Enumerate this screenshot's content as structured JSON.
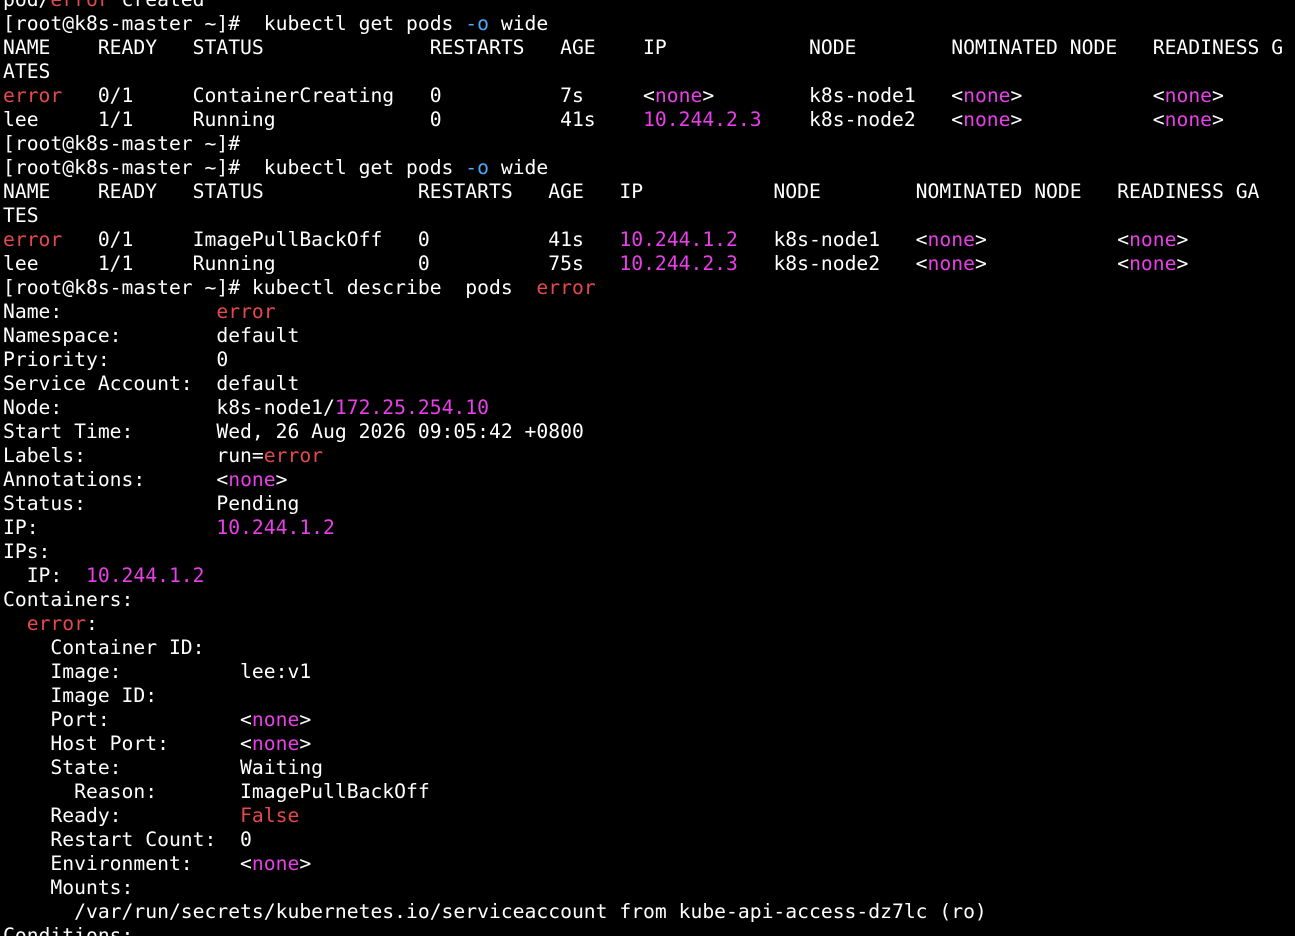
{
  "colors": {
    "background": "#000000",
    "default_text": "#ffffff",
    "red": "#e5484d",
    "magenta": "#e83fe8",
    "blue": "#4aa8ff"
  },
  "terminal": {
    "lines": [
      {
        "name": "output-created",
        "segs": [
          {
            "t": "pod/",
            "c": "t"
          },
          {
            "t": "error",
            "c": "r"
          },
          {
            "t": " created",
            "c": "t"
          }
        ]
      },
      {
        "name": "prompt-get-pods-1",
        "segs": [
          {
            "t": "[root@k8s-master ~]#  kubectl get pods ",
            "c": "t"
          },
          {
            "t": "-o",
            "c": "b"
          },
          {
            "t": " wide",
            "c": "t"
          }
        ]
      },
      {
        "name": "pods-header-1",
        "segs": [
          {
            "t": "NAME    READY   STATUS              RESTARTS   AGE    IP            NODE        NOMINATED NODE   READINESS G",
            "c": "t"
          }
        ]
      },
      {
        "name": "pods-header-1-wrap",
        "segs": [
          {
            "t": "ATES",
            "c": "t"
          }
        ]
      },
      {
        "name": "pod-row-error-1",
        "segs": [
          {
            "t": "error",
            "c": "r"
          },
          {
            "t": "   0/1     ContainerCreating   0          7s     <",
            "c": "t"
          },
          {
            "t": "none",
            "c": "m"
          },
          {
            "t": ">        k8s-node1   <",
            "c": "t"
          },
          {
            "t": "none",
            "c": "m"
          },
          {
            "t": ">           <",
            "c": "t"
          },
          {
            "t": "none",
            "c": "m"
          },
          {
            "t": ">",
            "c": "t"
          }
        ]
      },
      {
        "name": "pod-row-lee-1",
        "segs": [
          {
            "t": "lee     1/1     Running             0          41s    ",
            "c": "t"
          },
          {
            "t": "10.244.2.3",
            "c": "m"
          },
          {
            "t": "    k8s-node2   <",
            "c": "t"
          },
          {
            "t": "none",
            "c": "m"
          },
          {
            "t": ">           <",
            "c": "t"
          },
          {
            "t": "none",
            "c": "m"
          },
          {
            "t": ">",
            "c": "t"
          }
        ]
      },
      {
        "name": "prompt-empty",
        "segs": [
          {
            "t": "[root@k8s-master ~]#",
            "c": "t"
          }
        ]
      },
      {
        "name": "prompt-get-pods-2",
        "segs": [
          {
            "t": "[root@k8s-master ~]#  kubectl get pods ",
            "c": "t"
          },
          {
            "t": "-o",
            "c": "b"
          },
          {
            "t": " wide",
            "c": "t"
          }
        ]
      },
      {
        "name": "pods-header-2",
        "segs": [
          {
            "t": "NAME    READY   STATUS             RESTARTS   AGE   IP           NODE        NOMINATED NODE   READINESS GA",
            "c": "t"
          }
        ]
      },
      {
        "name": "pods-header-2-wrap",
        "segs": [
          {
            "t": "TES",
            "c": "t"
          }
        ]
      },
      {
        "name": "pod-row-error-2",
        "segs": [
          {
            "t": "error",
            "c": "r"
          },
          {
            "t": "   0/1     ImagePullBackOff   0          41s   ",
            "c": "t"
          },
          {
            "t": "10.244.1.2",
            "c": "m"
          },
          {
            "t": "   k8s-node1   <",
            "c": "t"
          },
          {
            "t": "none",
            "c": "m"
          },
          {
            "t": ">           <",
            "c": "t"
          },
          {
            "t": "none",
            "c": "m"
          },
          {
            "t": ">",
            "c": "t"
          }
        ]
      },
      {
        "name": "pod-row-lee-2",
        "segs": [
          {
            "t": "lee     1/1     Running            0          75s   ",
            "c": "t"
          },
          {
            "t": "10.244.2.3",
            "c": "m"
          },
          {
            "t": "   k8s-node2   <",
            "c": "t"
          },
          {
            "t": "none",
            "c": "m"
          },
          {
            "t": ">           <",
            "c": "t"
          },
          {
            "t": "none",
            "c": "m"
          },
          {
            "t": ">",
            "c": "t"
          }
        ]
      },
      {
        "name": "prompt-describe",
        "segs": [
          {
            "t": "[root@k8s-master ~]# kubectl describe  pods  ",
            "c": "t"
          },
          {
            "t": "error",
            "c": "r"
          }
        ]
      },
      {
        "name": "describe-name",
        "segs": [
          {
            "t": "Name:             ",
            "c": "t"
          },
          {
            "t": "error",
            "c": "r"
          }
        ]
      },
      {
        "name": "describe-namespace",
        "segs": [
          {
            "t": "Namespace:        default",
            "c": "t"
          }
        ]
      },
      {
        "name": "describe-priority",
        "segs": [
          {
            "t": "Priority:         0",
            "c": "t"
          }
        ]
      },
      {
        "name": "describe-service-account",
        "segs": [
          {
            "t": "Service Account:  default",
            "c": "t"
          }
        ]
      },
      {
        "name": "describe-node",
        "segs": [
          {
            "t": "Node:             k8s-node1/",
            "c": "t"
          },
          {
            "t": "172.25.254.10",
            "c": "m"
          }
        ]
      },
      {
        "name": "describe-start-time",
        "segs": [
          {
            "t": "Start Time:       Wed, 26 Aug 2026 09:05:42 +0800",
            "c": "t"
          }
        ]
      },
      {
        "name": "describe-labels",
        "segs": [
          {
            "t": "Labels:           run=",
            "c": "t"
          },
          {
            "t": "error",
            "c": "r"
          }
        ]
      },
      {
        "name": "describe-annotations",
        "segs": [
          {
            "t": "Annotations:      <",
            "c": "t"
          },
          {
            "t": "none",
            "c": "m"
          },
          {
            "t": ">",
            "c": "t"
          }
        ]
      },
      {
        "name": "describe-status",
        "segs": [
          {
            "t": "Status:           Pending",
            "c": "t"
          }
        ]
      },
      {
        "name": "describe-ip",
        "segs": [
          {
            "t": "IP:               ",
            "c": "t"
          },
          {
            "t": "10.244.1.2",
            "c": "m"
          }
        ]
      },
      {
        "name": "describe-ips",
        "segs": [
          {
            "t": "IPs:",
            "c": "t"
          }
        ]
      },
      {
        "name": "describe-ips-ip",
        "segs": [
          {
            "t": "  IP:  ",
            "c": "t"
          },
          {
            "t": "10.244.1.2",
            "c": "m"
          }
        ]
      },
      {
        "name": "describe-containers",
        "segs": [
          {
            "t": "Containers:",
            "c": "t"
          }
        ]
      },
      {
        "name": "describe-container-error",
        "segs": [
          {
            "t": "  ",
            "c": "t"
          },
          {
            "t": "error",
            "c": "r"
          },
          {
            "t": ":",
            "c": "t"
          }
        ]
      },
      {
        "name": "describe-container-id",
        "segs": [
          {
            "t": "    Container ID:",
            "c": "t"
          }
        ]
      },
      {
        "name": "describe-image",
        "segs": [
          {
            "t": "    Image:          lee:v1",
            "c": "t"
          }
        ]
      },
      {
        "name": "describe-image-id",
        "segs": [
          {
            "t": "    Image ID:",
            "c": "t"
          }
        ]
      },
      {
        "name": "describe-port",
        "segs": [
          {
            "t": "    Port:           <",
            "c": "t"
          },
          {
            "t": "none",
            "c": "m"
          },
          {
            "t": ">",
            "c": "t"
          }
        ]
      },
      {
        "name": "describe-host-port",
        "segs": [
          {
            "t": "    Host Port:      <",
            "c": "t"
          },
          {
            "t": "none",
            "c": "m"
          },
          {
            "t": ">",
            "c": "t"
          }
        ]
      },
      {
        "name": "describe-state",
        "segs": [
          {
            "t": "    State:          Waiting",
            "c": "t"
          }
        ]
      },
      {
        "name": "describe-reason",
        "segs": [
          {
            "t": "      Reason:       ImagePullBackOff",
            "c": "t"
          }
        ]
      },
      {
        "name": "describe-ready",
        "segs": [
          {
            "t": "    Ready:          ",
            "c": "t"
          },
          {
            "t": "False",
            "c": "r"
          }
        ]
      },
      {
        "name": "describe-restart-count",
        "segs": [
          {
            "t": "    Restart Count:  0",
            "c": "t"
          }
        ]
      },
      {
        "name": "describe-environment",
        "segs": [
          {
            "t": "    Environment:    <",
            "c": "t"
          },
          {
            "t": "none",
            "c": "m"
          },
          {
            "t": ">",
            "c": "t"
          }
        ]
      },
      {
        "name": "describe-mounts",
        "segs": [
          {
            "t": "    Mounts:",
            "c": "t"
          }
        ]
      },
      {
        "name": "describe-mount-path",
        "segs": [
          {
            "t": "      /var/run/secrets/kubernetes.io/serviceaccount from kube-api-access-dz7lc (ro)",
            "c": "t"
          }
        ]
      },
      {
        "name": "describe-conditions",
        "segs": [
          {
            "t": "Conditions:",
            "c": "t"
          }
        ]
      }
    ]
  }
}
